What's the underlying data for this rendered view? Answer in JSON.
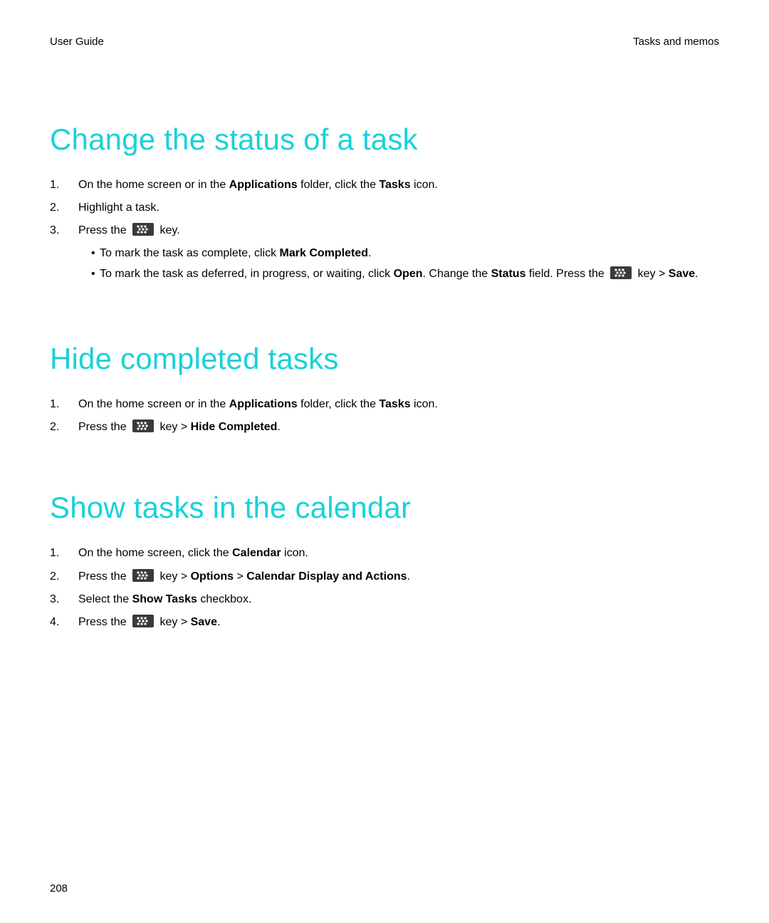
{
  "header": {
    "left": "User Guide",
    "right": "Tasks and memos"
  },
  "sections": {
    "change": {
      "title": "Change the status of a task",
      "s1": {
        "n": "1.",
        "a": "On the home screen or in the ",
        "b": "Applications",
        "c": " folder, click the ",
        "d": "Tasks",
        "e": " icon."
      },
      "s2": {
        "n": "2.",
        "a": "Highlight a task."
      },
      "s3": {
        "n": "3.",
        "a": "Press the ",
        "b": " key."
      },
      "b1": {
        "a": "To mark the task as complete, click ",
        "b": "Mark Completed",
        "c": "."
      },
      "b2": {
        "a": "To mark the task as deferred, in progress, or waiting, click ",
        "b": "Open",
        "c": ". Change the ",
        "d": "Status",
        "e": " field. Press the ",
        "f": " key > ",
        "g": "Save",
        "h": "."
      }
    },
    "hide": {
      "title": "Hide completed tasks",
      "s1": {
        "n": "1.",
        "a": "On the home screen or in the ",
        "b": "Applications",
        "c": " folder, click the ",
        "d": "Tasks",
        "e": " icon."
      },
      "s2": {
        "n": "2.",
        "a": "Press the ",
        "b": " key > ",
        "c": "Hide Completed",
        "d": "."
      }
    },
    "show": {
      "title": "Show tasks in the calendar",
      "s1": {
        "n": "1.",
        "a": "On the home screen, click the ",
        "b": "Calendar",
        "c": " icon."
      },
      "s2": {
        "n": "2.",
        "a": "Press the ",
        "b": " key > ",
        "c": "Options",
        "d": " > ",
        "e": "Calendar Display and Actions",
        "f": "."
      },
      "s3": {
        "n": "3.",
        "a": "Select the ",
        "b": "Show Tasks",
        "c": " checkbox."
      },
      "s4": {
        "n": "4.",
        "a": "Press the ",
        "b": " key > ",
        "c": "Save",
        "d": "."
      }
    }
  },
  "page_number": "208",
  "icons": {
    "bb_key": "blackberry-menu-key-icon"
  }
}
